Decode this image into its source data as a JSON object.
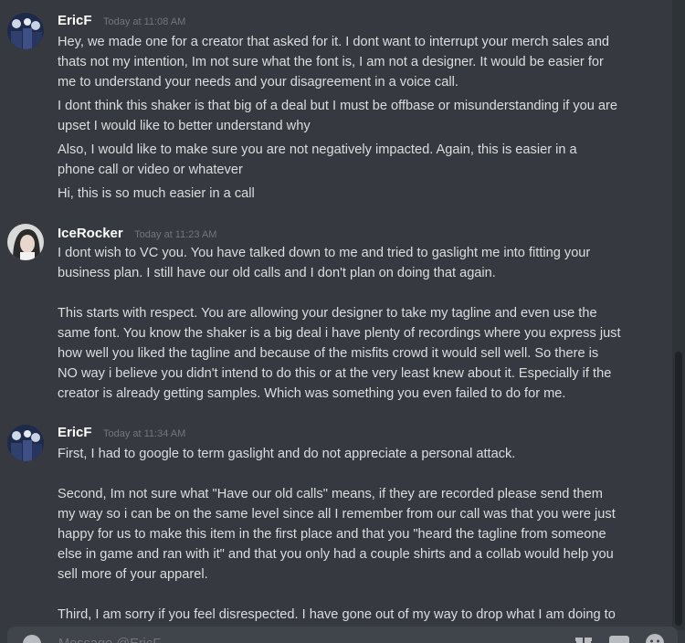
{
  "messages": [
    {
      "username": "EricF",
      "timestamp": "Today at 11:08 AM",
      "paragraphs": [
        "Hey, we made one for a creator that asked for it.  I dont want to interrupt your merch sales and\nthats not my intention, Im not sure what the font is, I am not a designer.  It would be easier for\nme to understand your needs and your disagreement in a voice call.",
        "I dont think this shaker is that big of a deal but I must be offbase or misunderstanding if you are\nupset I would like to better understand why",
        "Also, I would like to make sure you are not negatively impacted.  Again, this is easier in a\nphone call or video or whatever",
        "Hi, this is so much easier in a call"
      ]
    },
    {
      "username": "IceRocker",
      "timestamp": "Today at 11:23 AM",
      "paragraphs": [
        "I dont wish to VC you. You have talked down to me and tried to gaslight me into fitting your\nbusiness plan. I still have our old calls and I don't plan on doing that again.\n\nThis starts with respect. You are allowing your designer to take my tagline and even use the\nsame font. You know the shaker is a big deal i have plenty of recordings where you express just\nhow well you liked the tagline and because of the misfits crowd it would sell well. So there is\nNO way i believe you didn't intend to do this or at the very least knew about it. Especially if the\ncreator is already getting samples. Which was something you even failed to do for me."
      ]
    },
    {
      "username": "EricF",
      "timestamp": "Today at 11:34 AM",
      "paragraphs": [
        "First, I had to google to term gaslight and do not appreciate a personal attack.\n\nSecond, Im not sure what \"Have our old calls\" means, if they are recorded please send them\nmy way so i can be on the same level since all I remember from our call was that you were just\nhappy for us to make this item in the first place and that you \"heard the tagline from someone\nelse in game and ran with it\" and that you only had a couple shirts and a collab would help you\nsell more of your apparel.\n\nThird, I am sorry if you feel disrespected.  I have gone out of my way to drop what I am doing to"
      ]
    }
  ],
  "composer": {
    "placeholder": "Message @EricF"
  },
  "icons": {
    "add": "plus-circle-icon",
    "gift": "gift-icon",
    "gif": "gif-icon",
    "emoji": "emoji-icon"
  },
  "colors": {
    "background": "#36393f",
    "text": "#dcddde",
    "username": "#ffffff",
    "timestamp": "#72767d",
    "composer": "#40444b"
  }
}
